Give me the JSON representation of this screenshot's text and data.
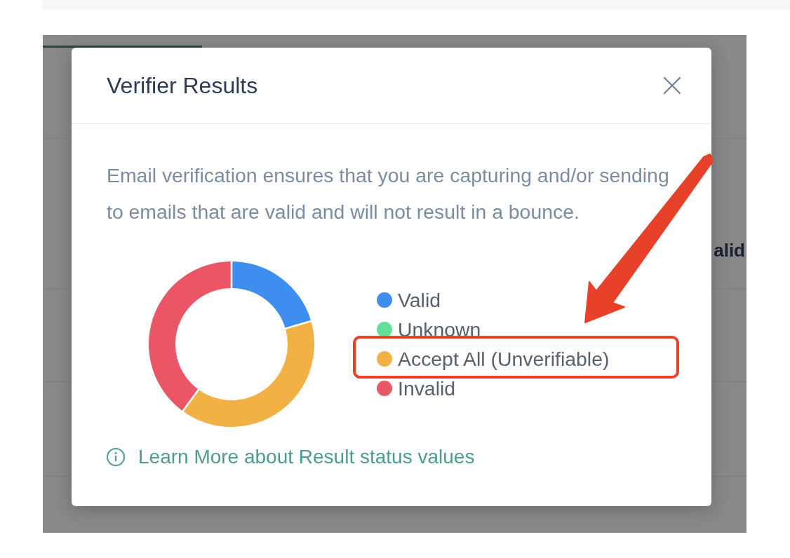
{
  "background_page": {
    "column_header": "alid"
  },
  "dialog": {
    "title": "Verifier Results",
    "description": "Email verification ensures that you are capturing and/or sending to emails that are valid and will not result in a bounce.",
    "chart_data": {
      "type": "donut",
      "values": [
        20.5,
        0,
        39.5,
        40
      ]
    },
    "legend": [
      {
        "label": "Valid",
        "color": "#3e8ef0",
        "highlighted": false
      },
      {
        "label": "Unknown",
        "color": "#63df98",
        "highlighted": false
      },
      {
        "label": "Accept All (Unverifiable)",
        "color": "#f2b144",
        "highlighted": true
      },
      {
        "label": "Invalid",
        "color": "#ea5666",
        "highlighted": false
      }
    ],
    "link": "Learn More about Result status values"
  }
}
